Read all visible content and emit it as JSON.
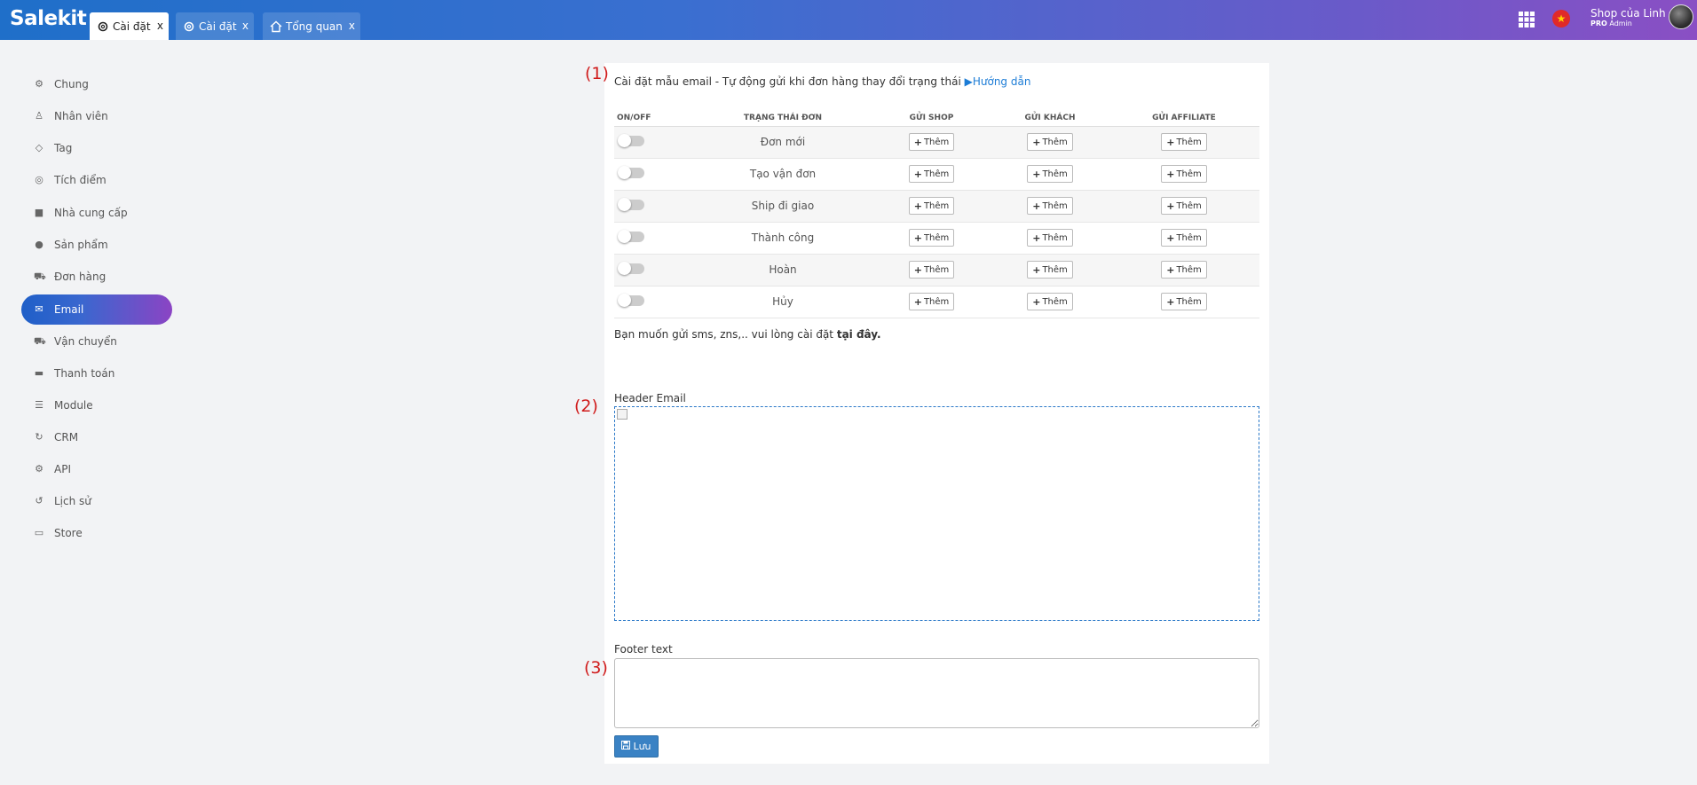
{
  "app": {
    "logo": "Salekit",
    "tabs": [
      {
        "label": "Cài đặt",
        "icon": "gear-icon",
        "active": true,
        "close": "x"
      },
      {
        "label": "Cài đặt",
        "icon": "gear-icon",
        "active": false,
        "close": "x"
      },
      {
        "label": "Tổng quan",
        "icon": "home-icon",
        "active": false,
        "close": "x"
      }
    ],
    "user": {
      "name": "Shop của Linh",
      "role_badge": "PRO",
      "role": "Admin"
    },
    "flag_symbol": "★"
  },
  "sidebar": {
    "items": [
      {
        "label": "Chung",
        "icon": "gear-icon",
        "glyph": "⚙"
      },
      {
        "label": "Nhân viên",
        "icon": "user-icon",
        "glyph": "♙"
      },
      {
        "label": "Tag",
        "icon": "tag-icon",
        "glyph": "◇"
      },
      {
        "label": "Tích điểm",
        "icon": "coins-icon",
        "glyph": "◎"
      },
      {
        "label": "Nhà cung cấp",
        "icon": "box-icon",
        "glyph": "■"
      },
      {
        "label": "Sản phẩm",
        "icon": "product-icon",
        "glyph": "●"
      },
      {
        "label": "Đơn hàng",
        "icon": "cart-icon",
        "glyph": "⛟"
      },
      {
        "label": "Email",
        "icon": "envelope-icon",
        "glyph": "✉",
        "active": true
      },
      {
        "label": "Vận chuyển",
        "icon": "truck-icon",
        "glyph": "⛟"
      },
      {
        "label": "Thanh toán",
        "icon": "money-icon",
        "glyph": "▬"
      },
      {
        "label": "Module",
        "icon": "database-icon",
        "glyph": "☰"
      },
      {
        "label": "CRM",
        "icon": "sync-icon",
        "glyph": "↻"
      },
      {
        "label": "API",
        "icon": "api-icon",
        "glyph": "⚙"
      },
      {
        "label": "Lịch sử",
        "icon": "history-icon",
        "glyph": "↺"
      },
      {
        "label": "Store",
        "icon": "store-icon",
        "glyph": "▭"
      }
    ]
  },
  "main": {
    "markers": [
      "(1)",
      "(2)",
      "(3)"
    ],
    "intro_text": "Cài đặt mẫu email - Tự động gửi khi đơn hàng thay đổi trạng thái",
    "guide_link": "Hướng dẫn",
    "table": {
      "headers": [
        "ON/OFF",
        "TRẠNG THÁI ĐƠN",
        "GỬI SHOP",
        "GỬI KHÁCH",
        "GỬI AFFILIATE"
      ],
      "add_label": "Thêm",
      "rows": [
        {
          "status": "Đơn mới",
          "enabled": false
        },
        {
          "status": "Tạo vận đơn",
          "enabled": false
        },
        {
          "status": "Ship đi giao",
          "enabled": false
        },
        {
          "status": "Thành công",
          "enabled": false
        },
        {
          "status": "Hoàn",
          "enabled": false
        },
        {
          "status": "Hủy",
          "enabled": false
        }
      ]
    },
    "sms_note": "Bạn muốn gửi sms, zns,.. vui lòng cài đặt ",
    "sms_link": "tại đây.",
    "header_label": "Header Email",
    "footer_label": "Footer text",
    "footer_value": "",
    "save_label": "Lưu"
  }
}
